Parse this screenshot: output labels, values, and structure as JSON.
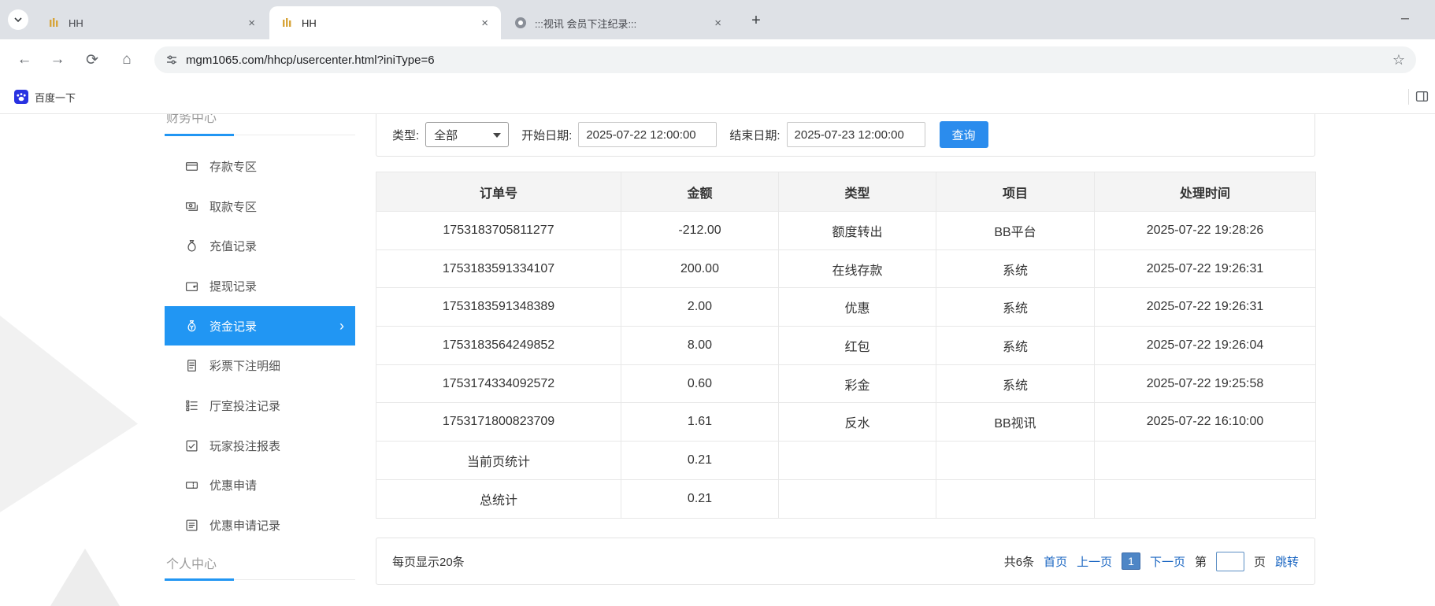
{
  "browser": {
    "tabs": [
      {
        "title": "HH"
      },
      {
        "title": "HH",
        "active": true
      },
      {
        "title": ":::视讯 会员下注纪录:::"
      }
    ],
    "url": "mgm1065.com/hhcp/usercenter.html?iniType=6",
    "bookmark_label": "百度一下"
  },
  "icons": {
    "back": "←",
    "forward": "→",
    "refresh": "⟳",
    "home": "⌂",
    "star": "☆",
    "new_tab": "+",
    "close_tab": "×",
    "minimize": "─",
    "chevron_right": "›"
  },
  "sidebar": {
    "section_top": "财务中心",
    "section_bottom": "个人中心",
    "items": [
      {
        "label": "存款专区",
        "icon": "deposit-card-icon"
      },
      {
        "label": "取款专区",
        "icon": "withdraw-cash-icon"
      },
      {
        "label": "充值记录",
        "icon": "recharge-record-icon"
      },
      {
        "label": "提现记录",
        "icon": "withdrawal-record-icon"
      },
      {
        "label": "资金记录",
        "icon": "fund-record-icon",
        "active": true
      },
      {
        "label": "彩票下注明细",
        "icon": "lottery-detail-icon"
      },
      {
        "label": "厅室投注记录",
        "icon": "hall-bet-record-icon"
      },
      {
        "label": "玩家投注报表",
        "icon": "player-report-icon"
      },
      {
        "label": "优惠申请",
        "icon": "promo-apply-icon"
      },
      {
        "label": "优惠申请记录",
        "icon": "promo-record-icon"
      }
    ]
  },
  "filters": {
    "type_label": "类型:",
    "type_value": "全部",
    "start_label": "开始日期:",
    "start_value": "2025-07-22 12:00:00",
    "end_label": "结束日期:",
    "end_value": "2025-07-23 12:00:00",
    "search_button": "查询"
  },
  "table": {
    "headers": [
      "订单号",
      "金额",
      "类型",
      "项目",
      "处理时间"
    ],
    "rows": [
      [
        "1753183705811277",
        "-212.00",
        "额度转出",
        "BB平台",
        "2025-07-22 19:28:26"
      ],
      [
        "1753183591334107",
        "200.00",
        "在线存款",
        "系统",
        "2025-07-22 19:26:31"
      ],
      [
        "1753183591348389",
        "2.00",
        "优惠",
        "系统",
        "2025-07-22 19:26:31"
      ],
      [
        "1753183564249852",
        "8.00",
        "红包",
        "系统",
        "2025-07-22 19:26:04"
      ],
      [
        "1753174334092572",
        "0.60",
        "彩金",
        "系统",
        "2025-07-22 19:25:58"
      ],
      [
        "1753171800823709",
        "1.61",
        "反水",
        "BB视讯",
        "2025-07-22 16:10:00"
      ],
      [
        "当前页统计",
        "0.21",
        "",
        "",
        ""
      ],
      [
        "总统计",
        "0.21",
        "",
        "",
        ""
      ]
    ]
  },
  "pagination": {
    "per_page": "每页显示20条",
    "total": "共6条",
    "first": "首页",
    "prev": "上一页",
    "current": "1",
    "next": "下一页",
    "jump_pre": "第",
    "jump_post": "页",
    "jump": "跳转"
  },
  "colors": {
    "accent_blue": "#2196f3",
    "link_blue": "#1a66c2",
    "button_blue": "#2b8ced",
    "table_header_bg": "#f4f4f4",
    "tabstrip_bg": "#dee1e6"
  }
}
